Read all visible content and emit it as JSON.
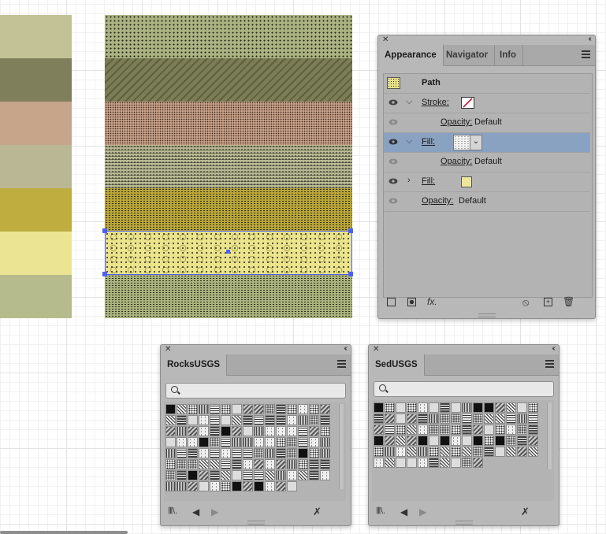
{
  "canvas": {
    "swatches": [
      "#c3c296",
      "#7f7f5c",
      "#c7a58a",
      "#bab794",
      "#bfad40",
      "#ebe593",
      "#b5bb8c"
    ],
    "bands": [
      {
        "color": "#abb282",
        "pattern": "dots"
      },
      {
        "color": "#7b7d56",
        "pattern": "dash"
      },
      {
        "color": "#c8a187",
        "pattern": "fine"
      },
      {
        "color": "#b9b993",
        "pattern": "lines"
      },
      {
        "color": "#b8a53a",
        "pattern": "dots2"
      },
      {
        "color": "#ebe48b",
        "pattern": "circ"
      },
      {
        "color": "#aab27e",
        "pattern": "dots2"
      }
    ]
  },
  "appearance_panel": {
    "tabs": [
      "Appearance",
      "Navigator",
      "Info"
    ],
    "path_label": "Path",
    "rows": [
      {
        "label": "Stroke:",
        "kind": "stroke"
      },
      {
        "label": "Opacity:",
        "value": "Default"
      },
      {
        "label": "Fill:",
        "kind": "fill-pattern",
        "selected": true
      },
      {
        "label": "Opacity:",
        "value": "Default"
      },
      {
        "label": "Fill:",
        "kind": "fill-color"
      },
      {
        "label": "Opacity:",
        "value": "Default"
      }
    ],
    "fill_color": "#ece79a",
    "selection_color": "#8aa2c2",
    "tools": {
      "fx": "fx."
    }
  },
  "rocks_panel": {
    "title": "RocksUSGS",
    "search_placeholder": ""
  },
  "sed_panel": {
    "title": "SedUSGS",
    "search_placeholder": ""
  }
}
